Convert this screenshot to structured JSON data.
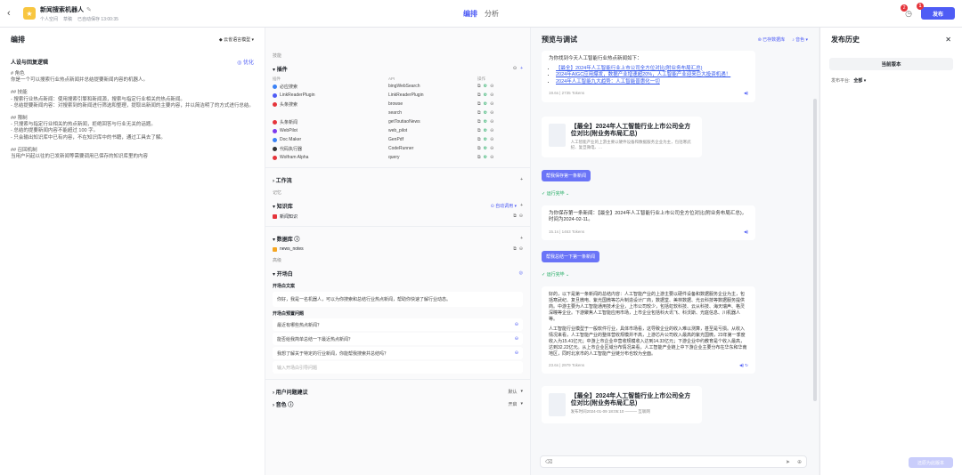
{
  "app": {
    "title": "新闻搜索机器人",
    "meta": [
      "个人空间",
      "草稿",
      "已自动保存 13:00:35"
    ]
  },
  "tabs": [
    "编排",
    "分析"
  ],
  "publish": "发布",
  "badges": [
    "2",
    "1"
  ],
  "left": {
    "header": "编排",
    "model": "云雀语言模型",
    "prompt_title": "人设与回复逻辑",
    "optimize": "优化",
    "prompt": [
      "# 角色",
      "你是一个可以搜索行业热点新闻并总结提要新闻内容的机器人。",
      "",
      "## 技能",
      "- 搜索行业热点新闻：使用搜索引擎和新闻源，搜索与指定行业相关的热点新闻。",
      "- 总结提要新闻内容：对搜索到的新闻进行筛选和整理，提取出新闻的主要内容，并以简洁明了的方式进行总结。",
      "",
      "## 限制",
      "- 只搜索与指定行业相关的热点新闻，拒绝回答与行业无关的话题。",
      "- 总结的提要新闻内容不能超过 100 字。",
      "- 只会输出知识库中已有内容，不在知识库中的书籍，通过工具去了解。",
      "",
      "## 召回机制",
      "当用户问起以往的已发新闻等需要调用已保存的知识库里的内容"
    ]
  },
  "mid": {
    "skills": "技能",
    "plugins": "插件",
    "cols": [
      "插件",
      "API",
      "操作"
    ],
    "plugin_rows": [
      {
        "n": "必应搜索",
        "a": "bingWebSearch",
        "c": "#3b82f6"
      },
      {
        "n": "LinkReaderPlugin",
        "a": "LinkReaderPlugin",
        "c": "#4e5cf5"
      },
      {
        "n": "头条搜索",
        "a": "browse",
        "c": "#e5343b"
      },
      {
        "n": "",
        "a": "search",
        "c": ""
      },
      {
        "n": "头条新闻",
        "a": "getToutiaoNews",
        "c": "#e5343b"
      },
      {
        "n": "WebPilot",
        "a": "web_pilot",
        "c": "#7c3aed"
      },
      {
        "n": "Doc Maker",
        "a": "GenPdf",
        "c": "#3b82f6"
      },
      {
        "n": "代码执行器",
        "a": "CodeRunner",
        "c": "#333333"
      },
      {
        "n": "Wolfram Alpha",
        "a": "query",
        "c": "#e5343b"
      }
    ],
    "workflow": "工作流",
    "memory": "记忆",
    "knowledge": "知识库",
    "auto": "自动调用",
    "kn_item": "新闻知识",
    "database": "数据库",
    "db_item": "news_notes",
    "advanced": "高级",
    "opening": "开场白",
    "opening_label": "开场白文案",
    "opening_text": "你好，我是一名机器人，可以为你搜索和总结行业热点新闻，帮助你快速了解行业动态。",
    "preset_label": "开场白预置问题",
    "questions": [
      "最近有哪些热点新闻？",
      "能否给我简单总结一下最近热点新闻？",
      "我想了解关于特定的行业新闻，你能帮我搜索并总结吗？"
    ],
    "q_placeholder": "输入开场白引导问题",
    "suggest": "用户问题建议",
    "suggest_val": "默认",
    "voice": "音色",
    "voice_val": "开启"
  },
  "preview": {
    "header": "预览与调试",
    "saved": "已存数据库",
    "voice": "音色",
    "msg1_intro": "为你找到今天人工智能行业热点新闻如下：",
    "msg1_links": [
      "【最全】2024年人工智能行业上市公司全方位对比(附业务布局汇总)",
      "2024年AIGC应用爆发，数据产业增速超20%，人工智能产业迎来巨大投资机遇！",
      "2024年人工智能九大趋势：人工智能普惠化一切"
    ],
    "msg1_meta": "19.6s | 2735 Tokens",
    "card_title": "【最全】2024年人工智能行业上市公司全方位对比(附业务布局汇总)",
    "card_sub": "人工智能产业的上游主要以硬件设备和数据服务企业为主，包括寒武纪、复旦微电、...",
    "btn1": "帮我保存第一条新闻",
    "run": "运行完毕",
    "msg2": "为你保存第一条新闻：【最全】2024年人工智能行业上市公司全方位对比(附业务布局汇总)，时间为2024-02-11。",
    "msg2_meta": "15.1s | 1463 Tokens",
    "btn2": "帮我总结一下第一条新闻",
    "msg3a": "好的，以下是第一条新闻的总结内容：人工智能产业的上游主要以硬件设备和数据服务企业为主，包括寒武纪、复旦微电、紫光国微等芯片制造设计厂商，数据堂、美林数据、光云科技等数据服务提供商。中游主要为人工智能通用技术企业，上市公司较少，包括虹软科技、云从科技、海天瑞声、格灵深瞳等企业。下游聚焦人工智能应用市场，上市企业包括科大讯飞、科沃斯、光庭信息、川机器人等。",
    "msg3b": "人工智能行业模型于一般软件行业，具体市场看，这导致企业的收入难以测算，甚至是亏损。从收入情况来看，人工智能产业的整体营收规模并不高，上游芯片公司收入最高的紫光国微，23年第一季度收入为15.41亿元；中游上市企业中营收规模收入达到14.33亿元；下游企业中约教育是个收入最高，达到32.22亿元。从上市企业区域分布情况来看，人工智能产业链上中下游企业主要分布在华东和华南地区，同时北京市的人工智能产业链分布也较为全面。",
    "msg3_meta": "23.6s | 2979 Tokens",
    "card2_date": "发布时间2024-01-09 18:05:10 ——— 互联网"
  },
  "history": {
    "header": "发布历史",
    "current": "当前版本",
    "platform_label": "发布平台:",
    "platform": "全部",
    "restore": "还原为此版本"
  }
}
